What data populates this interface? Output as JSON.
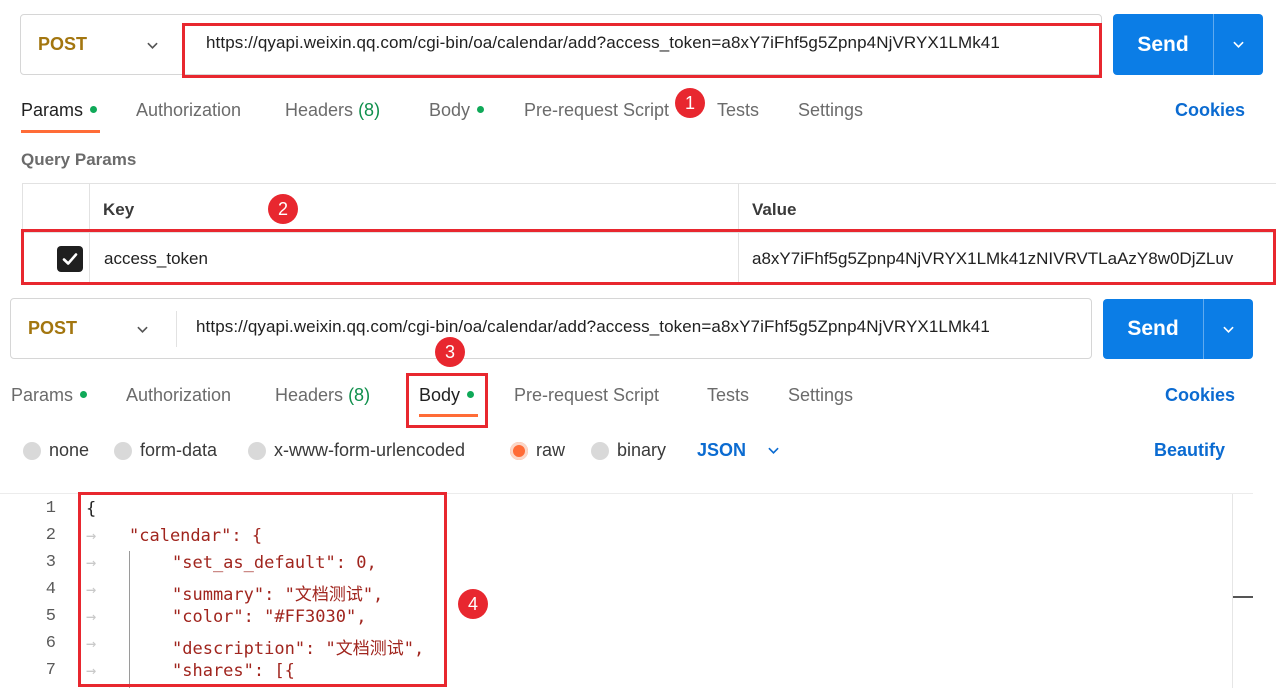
{
  "top": {
    "method": "POST",
    "url": "https://qyapi.weixin.qq.com/cgi-bin/oa/calendar/add?access_token=a8xY7iFhf5g5Zpnp4NjVRYX1LMk41",
    "send_label": "Send",
    "tabs": [
      {
        "label": "Params",
        "dot": true
      },
      {
        "label": "Authorization"
      },
      {
        "label": "Headers",
        "count": "(8)"
      },
      {
        "label": "Body",
        "dot": true
      },
      {
        "label": "Pre-request Script"
      },
      {
        "label": "Tests"
      },
      {
        "label": "Settings"
      }
    ],
    "active_tab": "Params",
    "cookies_label": "Cookies",
    "query_params_title": "Query Params",
    "table": {
      "headers": [
        "Key",
        "Value"
      ],
      "rows": [
        {
          "checked": true,
          "key": "access_token",
          "value": "a8xY7iFhf5g5Zpnp4NjVRYX1LMk41zNIVRVTLaAzY8w0DjZLuv"
        }
      ]
    }
  },
  "bottom": {
    "method": "POST",
    "url": "https://qyapi.weixin.qq.com/cgi-bin/oa/calendar/add?access_token=a8xY7iFhf5g5Zpnp4NjVRYX1LMk41",
    "send_label": "Send",
    "tabs": [
      {
        "label": "Params",
        "dot": true
      },
      {
        "label": "Authorization"
      },
      {
        "label": "Headers",
        "count": "(8)"
      },
      {
        "label": "Body",
        "dot": true
      },
      {
        "label": "Pre-request Script"
      },
      {
        "label": "Tests"
      },
      {
        "label": "Settings"
      }
    ],
    "active_tab": "Body",
    "cookies_label": "Cookies",
    "body_modes": [
      {
        "label": "none",
        "selected": false
      },
      {
        "label": "form-data",
        "selected": false
      },
      {
        "label": "x-www-form-urlencoded",
        "selected": false
      },
      {
        "label": "raw",
        "selected": true
      },
      {
        "label": "binary",
        "selected": false
      }
    ],
    "format": "JSON",
    "beautify_label": "Beautify",
    "code_lines": [
      {
        "n": "1",
        "text": "{"
      },
      {
        "n": "2",
        "text": "\"calendar\": {"
      },
      {
        "n": "3",
        "text": "\"set_as_default\": 0,"
      },
      {
        "n": "4",
        "text": "\"summary\": \"文档测试\","
      },
      {
        "n": "5",
        "text": "\"color\": \"#FF3030\","
      },
      {
        "n": "6",
        "text": "\"description\": \"文档测试\","
      },
      {
        "n": "7",
        "text": "\"shares\": [{"
      }
    ]
  },
  "annotations": [
    "1",
    "2",
    "3",
    "4"
  ],
  "colors": {
    "accent": "#0b7de6",
    "active_underline": "#ff6c37",
    "annotation": "#e8272f",
    "method": "#a3760f",
    "status_dot": "#0fa958"
  }
}
